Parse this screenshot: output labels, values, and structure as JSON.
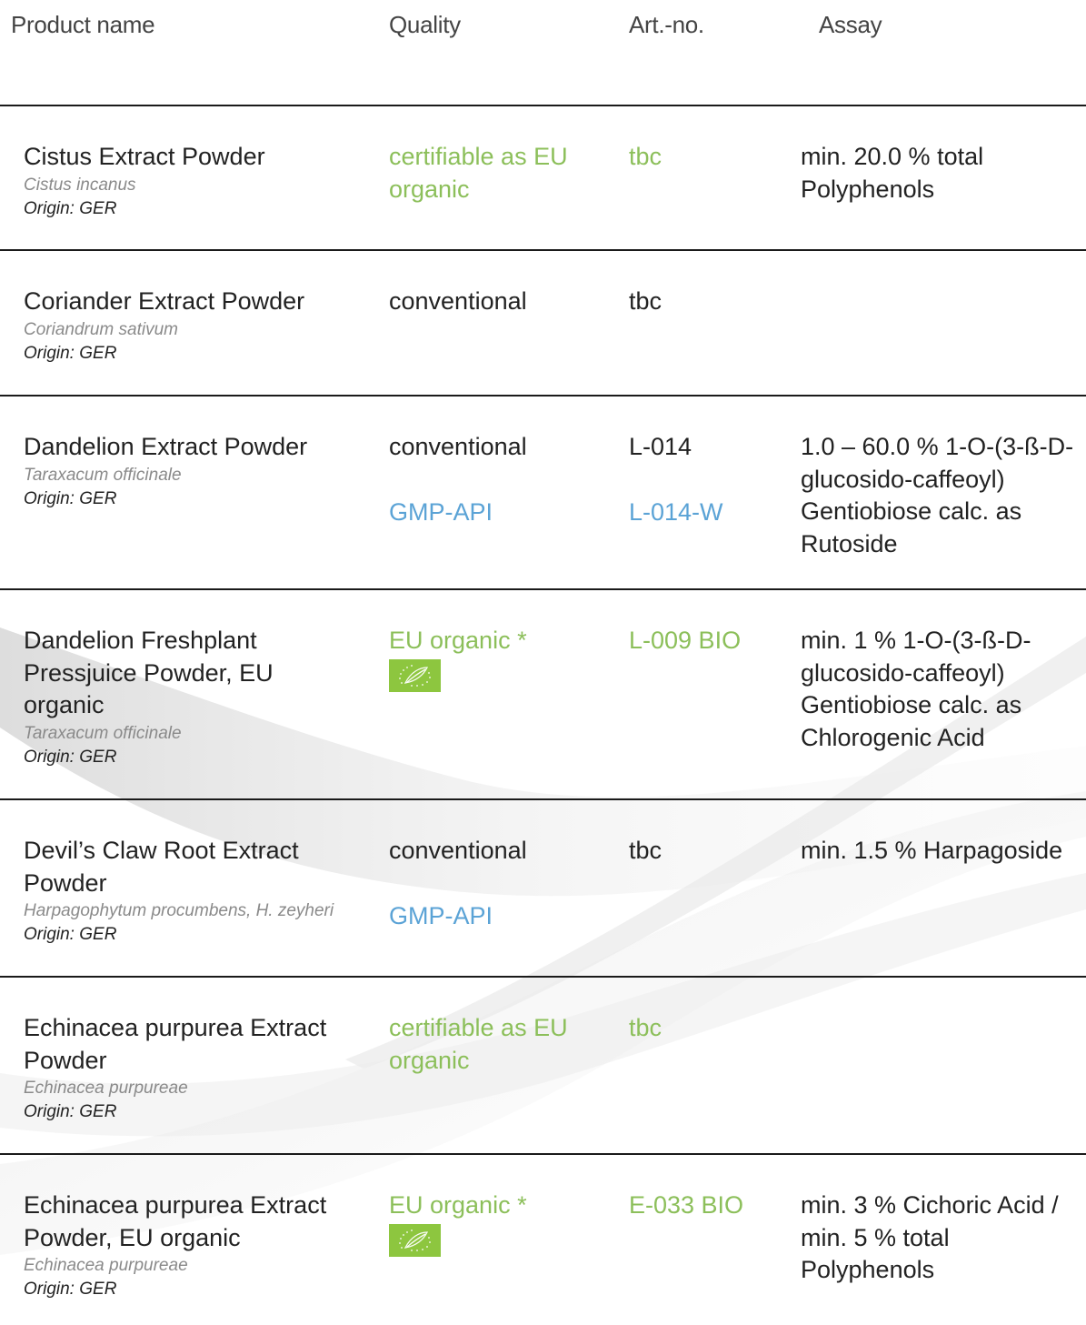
{
  "header": {
    "product": "Product name",
    "quality": "Quality",
    "art": "Art.-no.",
    "assay": "Assay"
  },
  "rows": [
    {
      "name": "Cistus Extract Powder",
      "latin": "Cistus incanus",
      "origin": "Origin: GER",
      "quality": [
        "certifiable as EU organic"
      ],
      "art": [
        "tbc"
      ],
      "assay": "min. 20.0 % total Polyphenols"
    },
    {
      "name": "Coriander Extract Powder",
      "latin": "Coriandrum sativum",
      "origin": "Origin: GER",
      "quality": [
        "conventional"
      ],
      "art": [
        "tbc"
      ],
      "assay": ""
    },
    {
      "name": "Dandelion Extract Powder",
      "latin": "Taraxacum officinale",
      "origin": "Origin: GER",
      "quality": [
        "conventional",
        "GMP-API"
      ],
      "art": [
        "L-014",
        "L-014-W"
      ],
      "assay": "1.0 – 60.0 % 1-O-(3-ß-D-glucosido-caffeoyl) Gentiobiose calc. as Rutoside"
    },
    {
      "name": "Dandelion Freshplant Pressjuice Powder, EU organic",
      "latin": "Taraxacum officinale",
      "origin": "Origin: GER",
      "quality": [
        "EU organic *"
      ],
      "art": [
        "L-009 BIO"
      ],
      "assay": "min. 1 % 1-O-(3-ß-D-glucosido-caffeoyl) Gentiobiose calc. as Chlorogenic Acid"
    },
    {
      "name": "Devil’s Claw Root Extract Powder",
      "latin": "Harpagophytum procumbens, H. zeyheri",
      "origin": "Origin: GER",
      "quality": [
        "conventional",
        "GMP-API"
      ],
      "art": [
        "tbc"
      ],
      "assay": "min. 1.5 % Harpagoside"
    },
    {
      "name": "Echinacea purpurea Extract Powder",
      "latin": "Echinacea purpureae",
      "origin": "Origin: GER",
      "quality": [
        "certifiable as EU organic"
      ],
      "art": [
        "tbc"
      ],
      "assay": ""
    },
    {
      "name": "Echinacea purpurea Extract Powder, EU organic",
      "latin": "Echinacea purpureae",
      "origin": "Origin: GER",
      "quality": [
        "EU organic *"
      ],
      "art": [
        "E-033 BIO"
      ],
      "assay": "min. 3 % Cichoric Acid / min. 5 % total Polyphenols"
    }
  ],
  "colors": {
    "organic_green": "#8cbf5a",
    "gmp_blue": "#5ba3d6",
    "text": "#222222",
    "latin_gray": "#8a8a8a"
  },
  "icons": [
    "eu-organic-leaf-icon"
  ]
}
